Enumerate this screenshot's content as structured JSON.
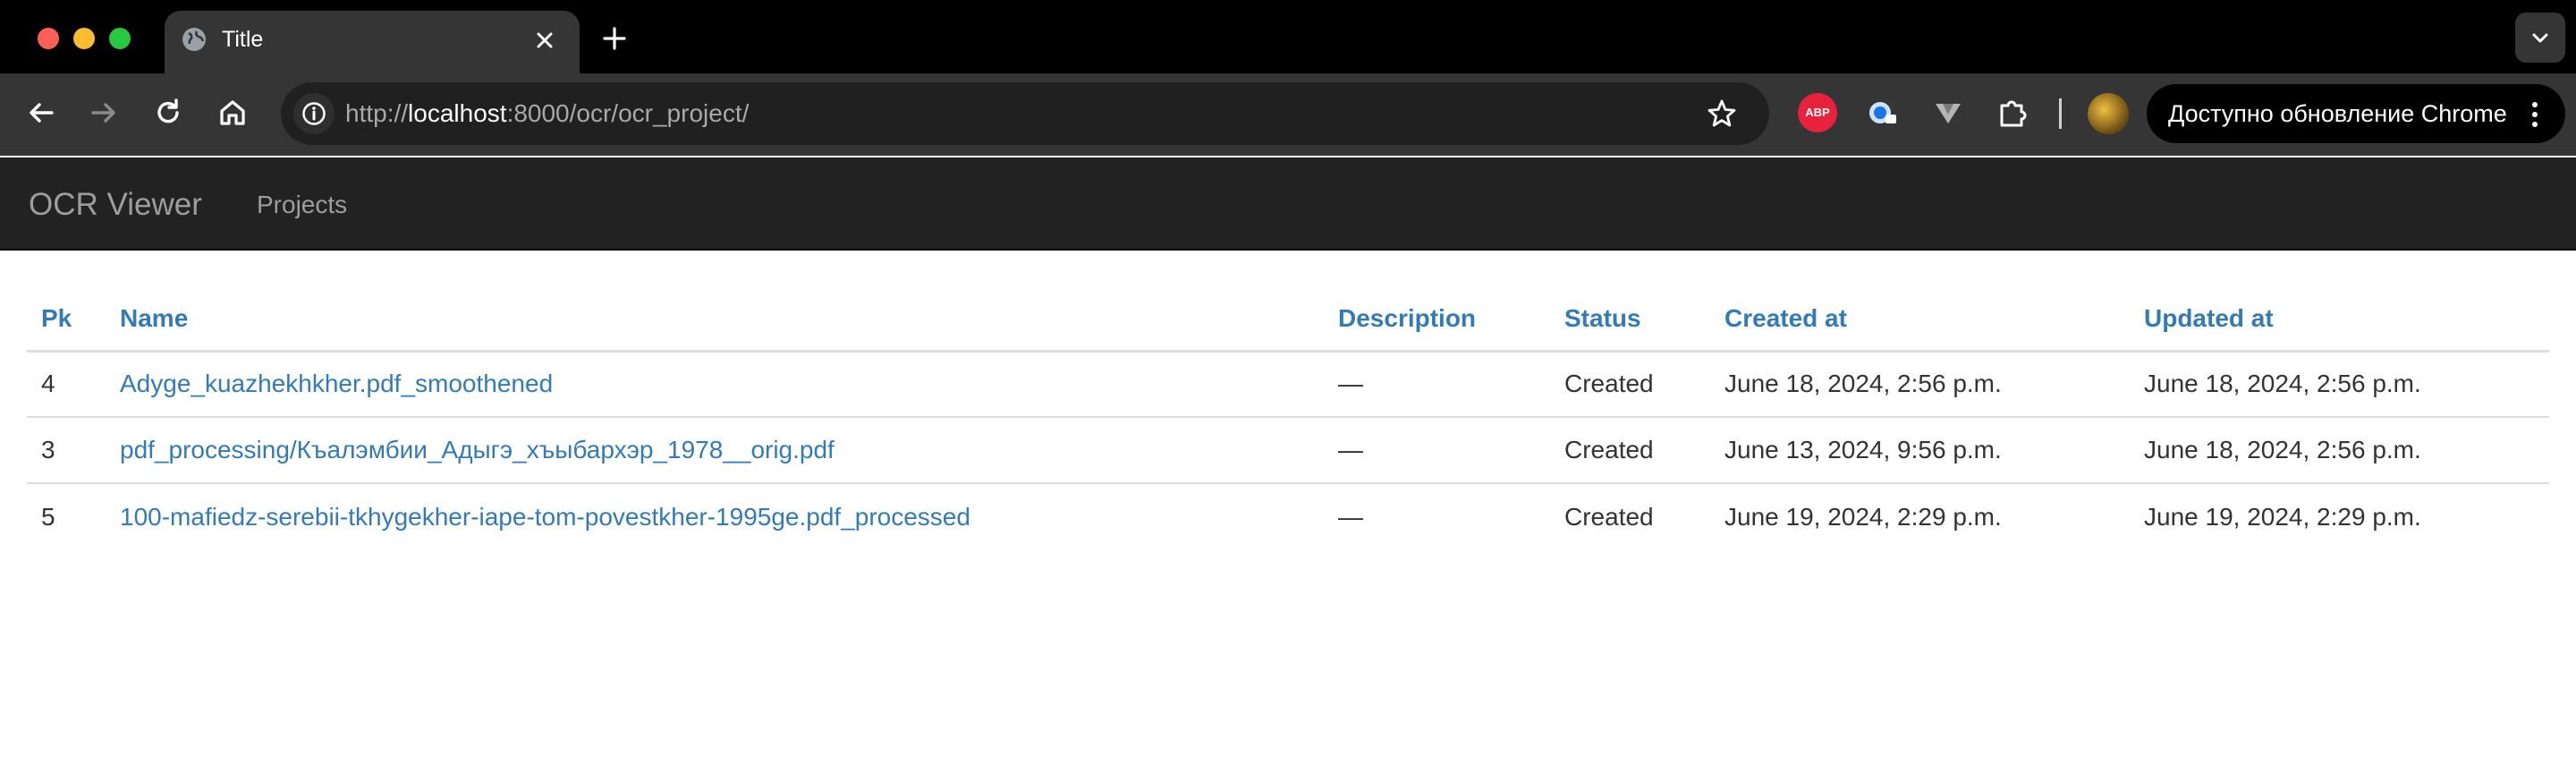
{
  "browser": {
    "tab_title": "Title",
    "url_scheme": "http://",
    "url_host": "localhost",
    "url_rest": ":8000/ocr/ocr_project/",
    "update_button_label": "Доступно обновление Chrome",
    "abp_label": "ABP",
    "icons": [
      "globe-icon",
      "close-icon",
      "plus-icon",
      "chevron-down-icon",
      "back-icon",
      "forward-icon",
      "reload-icon",
      "home-icon",
      "info-icon",
      "star-icon",
      "abp-icon",
      "password-icon",
      "extension-v-icon",
      "puzzle-icon",
      "avatar",
      "kebab-icon"
    ]
  },
  "navbar": {
    "brand": "OCR Viewer",
    "links": [
      "Projects"
    ]
  },
  "table": {
    "headers": [
      "Pk",
      "Name",
      "Description",
      "Status",
      "Created at",
      "Updated at"
    ],
    "rows": [
      {
        "pk": "4",
        "name": "Adyge_kuazhekhkher.pdf_smoothened",
        "description": "—",
        "status": "Created",
        "created_at": "June 18, 2024, 2:56 p.m.",
        "updated_at": "June 18, 2024, 2:56 p.m."
      },
      {
        "pk": "3",
        "name": "pdf_processing/Къалэмбии_Адыгэ_хъыбархэр_1978__orig.pdf",
        "description": "—",
        "status": "Created",
        "created_at": "June 13, 2024, 9:56 p.m.",
        "updated_at": "June 18, 2024, 2:56 p.m."
      },
      {
        "pk": "5",
        "name": "100-mafiedz-serebii-tkhygekher-iape-tom-povestkher-1995ge.pdf_processed",
        "description": "—",
        "status": "Created",
        "created_at": "June 19, 2024, 2:29 p.m.",
        "updated_at": "June 19, 2024, 2:29 p.m."
      }
    ]
  },
  "colors": {
    "link": "#337ab7",
    "navbar_bg": "#222222",
    "navbar_text": "#9d9d9d",
    "chrome_bg": "#000000",
    "toolbar_bg": "#353535"
  }
}
